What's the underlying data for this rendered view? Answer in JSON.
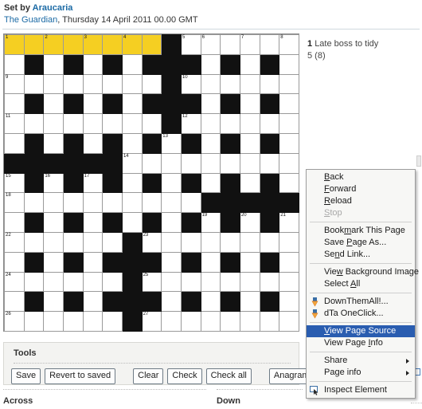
{
  "header": {
    "set_by_prefix": "Set by ",
    "setter": "Araucaria",
    "paper": "The Guardian",
    "pubinfo": ", Thursday 14 April 2011 00.00 GMT"
  },
  "clue": {
    "number": "1",
    "text": "Late boss to tidy",
    "second_line": "5 (8)"
  },
  "tools": {
    "title": "Tools",
    "buttons": [
      {
        "label": "Save",
        "name": "save-button"
      },
      {
        "label": "Revert to saved",
        "name": "revert-to-saved-button"
      },
      {
        "label": "Clear",
        "name": "clear-button"
      },
      {
        "label": "Check",
        "name": "check-button"
      },
      {
        "label": "Check all",
        "name": "check-all-button"
      },
      {
        "label": "Anagram",
        "name": "anagram-button"
      }
    ]
  },
  "clue_headings": {
    "across": "Across",
    "down": "Down"
  },
  "context_menu": {
    "items": [
      {
        "label": "Back",
        "accel": "B",
        "type": "item",
        "state": "normal",
        "icon": null
      },
      {
        "label": "Forward",
        "accel": "F",
        "type": "item",
        "state": "normal",
        "icon": null
      },
      {
        "label": "Reload",
        "accel": "R",
        "type": "item",
        "state": "normal",
        "icon": null
      },
      {
        "label": "Stop",
        "accel": "S",
        "type": "item",
        "state": "disabled",
        "icon": null
      },
      {
        "type": "separator"
      },
      {
        "label": "Bookmark This Page",
        "accel": "m",
        "type": "item",
        "state": "normal",
        "icon": null
      },
      {
        "label": "Save Page As...",
        "accel": "P",
        "type": "item",
        "state": "normal",
        "icon": null
      },
      {
        "label": "Send Link...",
        "accel": "n",
        "type": "item",
        "state": "normal",
        "icon": null
      },
      {
        "type": "separator"
      },
      {
        "label": "View Background Image",
        "accel": "w",
        "type": "item",
        "state": "normal",
        "icon": null
      },
      {
        "label": "Select All",
        "accel": "A",
        "type": "item",
        "state": "normal",
        "icon": null
      },
      {
        "type": "separator"
      },
      {
        "label": "DownThemAll!...",
        "type": "item",
        "state": "normal",
        "icon": "down-arrow-icon"
      },
      {
        "label": "dTa OneClick...",
        "type": "item",
        "state": "normal",
        "icon": "down-arrow-icon"
      },
      {
        "type": "separator"
      },
      {
        "label": "View Page Source",
        "accel": "V",
        "type": "item",
        "state": "selected",
        "icon": null
      },
      {
        "label": "View Page Info",
        "accel": "I",
        "type": "item",
        "state": "normal",
        "icon": null
      },
      {
        "type": "separator"
      },
      {
        "label": "Share",
        "type": "submenu",
        "state": "normal",
        "icon": null
      },
      {
        "label": "Page info",
        "type": "submenu",
        "state": "normal",
        "icon": null
      },
      {
        "type": "separator"
      },
      {
        "label": "Inspect Element",
        "type": "item",
        "state": "normal",
        "icon": "inspect-element-icon"
      }
    ]
  },
  "colors": {
    "highlight_cell": "#f5cf22",
    "block_cell": "#111111",
    "link": "#1b6aa5",
    "menu_selection": "#2a5db0"
  },
  "grid": {
    "rows": 15,
    "cols": 15,
    "numbers": {
      "0_0": "1",
      "0_2": "2",
      "0_4": "3",
      "0_6": "4",
      "0_9": "5",
      "0_10": "6",
      "0_12": "7",
      "0_14": "8",
      "2_0": "9",
      "2_9": "10",
      "4_0": "11",
      "4_9": "12",
      "5_8": "13",
      "6_6": "14",
      "7_0": "15",
      "7_2": "16",
      "7_4": "17",
      "8_0": "18",
      "9_10": "19",
      "9_12": "20",
      "9_14": "21",
      "10_0": "22",
      "10_7": "23",
      "12_0": "24",
      "12_7": "25",
      "14_0": "26",
      "14_7": "27"
    },
    "highlight": [
      "0_0",
      "0_1",
      "0_2",
      "0_3",
      "0_4",
      "0_5",
      "0_6",
      "0_7"
    ],
    "blocks": [
      "0_8",
      "1_1",
      "1_3",
      "1_5",
      "1_7",
      "1_8",
      "1_9",
      "1_11",
      "1_13",
      "2_8",
      "3_1",
      "3_3",
      "3_5",
      "3_7",
      "3_8",
      "3_9",
      "3_11",
      "3_13",
      "4_8",
      "5_1",
      "5_3",
      "5_5",
      "5_7",
      "5_9",
      "5_11",
      "5_13",
      "6_0",
      "6_1",
      "6_2",
      "6_3",
      "6_4",
      "6_5",
      "7_1",
      "7_3",
      "7_5",
      "7_7",
      "7_9",
      "7_11",
      "7_13",
      "8_10",
      "8_11",
      "8_12",
      "8_13",
      "8_14",
      "9_1",
      "9_3",
      "9_5",
      "9_7",
      "9_9",
      "9_11",
      "9_13",
      "10_6",
      "11_1",
      "11_3",
      "11_5",
      "11_6",
      "11_7",
      "11_9",
      "11_11",
      "11_13",
      "12_6",
      "13_1",
      "13_3",
      "13_5",
      "13_6",
      "13_7",
      "13_9",
      "13_11",
      "13_13",
      "14_6"
    ]
  }
}
